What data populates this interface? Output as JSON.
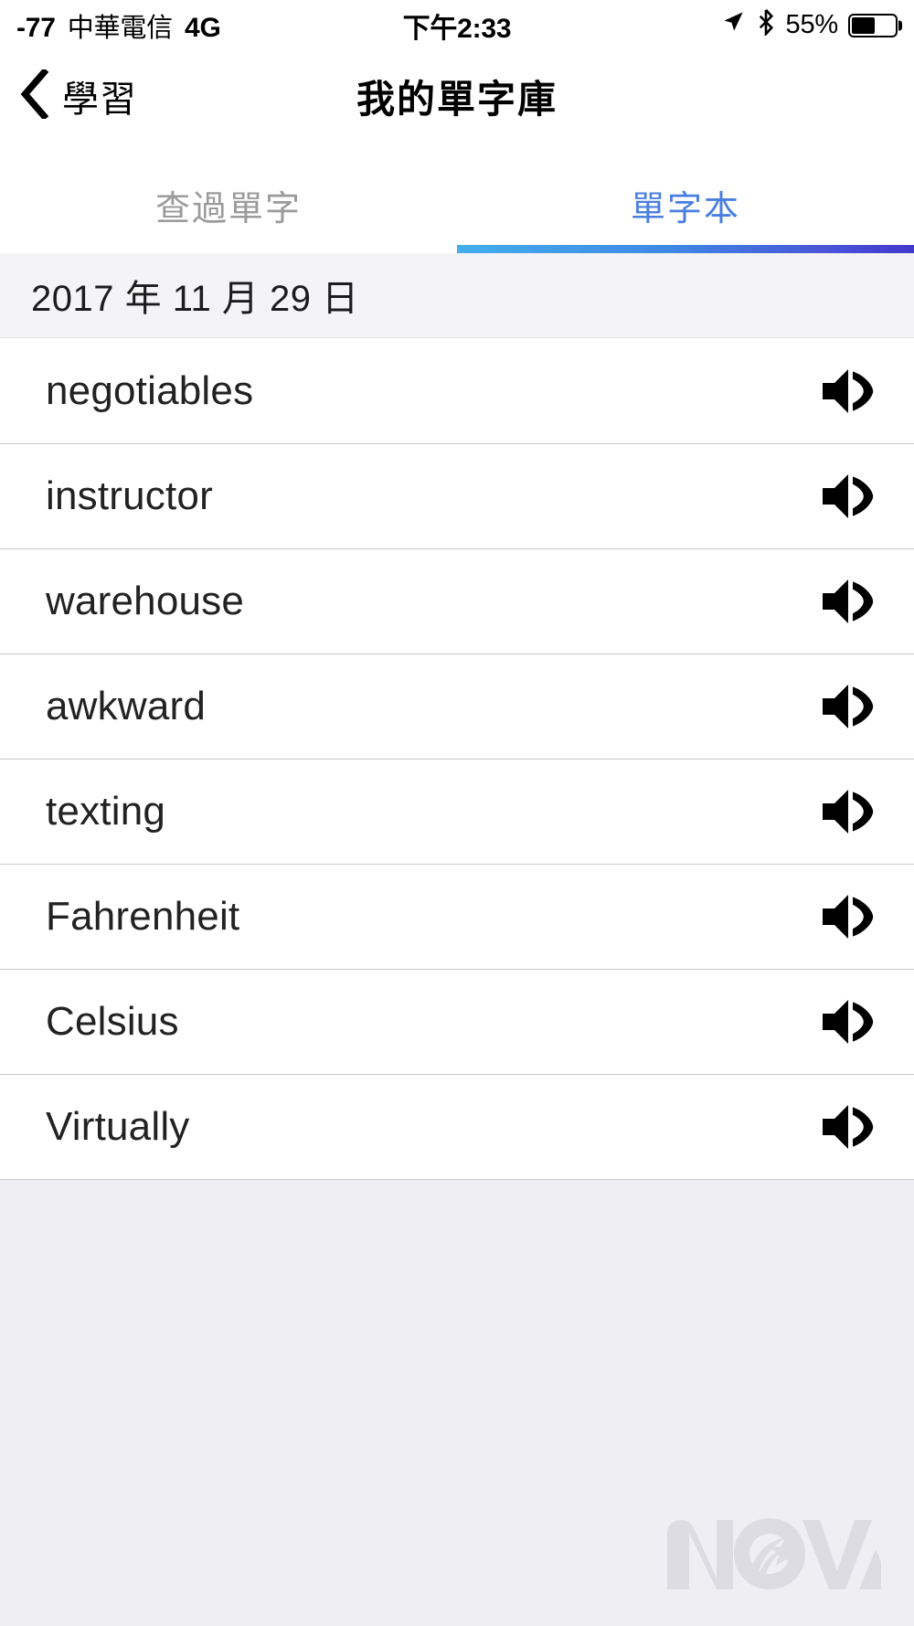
{
  "status_bar": {
    "signal_rssi": "-77",
    "carrier": "中華電信",
    "network_type": "4G",
    "time": "下午2:33",
    "location_icon": "location-arrow-icon",
    "bluetooth_icon": "bluetooth-icon",
    "battery_percent": "55%",
    "battery_level": 55
  },
  "nav_bar": {
    "back_icon": "chevron-left-icon",
    "back_label": "學習",
    "title": "我的單字庫"
  },
  "tabs": {
    "items": [
      {
        "label": "查過單字",
        "active": false
      },
      {
        "label": "單字本",
        "active": true
      }
    ],
    "active_index": 1,
    "indicator_gradient_start": "#44aeed",
    "indicator_gradient_end": "#4238cc",
    "active_color": "#4a7fe0",
    "inactive_color": "#9b9b9b"
  },
  "sections": [
    {
      "date_header": "2017 年 11 月 29 日",
      "rows": [
        {
          "word": "negotiables",
          "speaker_icon": "speaker-icon"
        },
        {
          "word": "instructor",
          "speaker_icon": "speaker-icon"
        },
        {
          "word": "warehouse",
          "speaker_icon": "speaker-icon"
        },
        {
          "word": "awkward",
          "speaker_icon": "speaker-icon"
        },
        {
          "word": "texting",
          "speaker_icon": "speaker-icon"
        },
        {
          "word": "Fahrenheit",
          "speaker_icon": "speaker-icon"
        },
        {
          "word": "Celsius",
          "speaker_icon": "speaker-icon"
        },
        {
          "word": "Virtually",
          "speaker_icon": "speaker-icon"
        }
      ]
    }
  ],
  "watermark": {
    "text": "NOVA",
    "color": "#dcdce2"
  }
}
